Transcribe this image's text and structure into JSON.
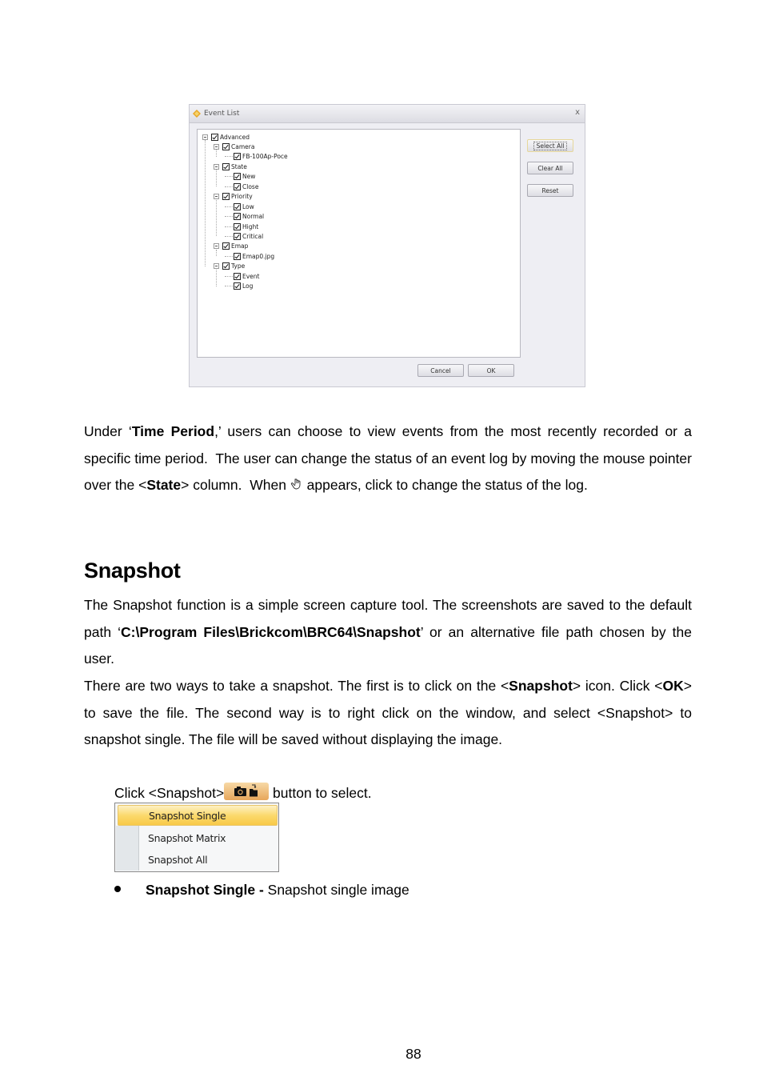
{
  "dialog": {
    "title": "Event List",
    "close_glyph": "x",
    "tree": [
      {
        "label": "Advanced",
        "level": 0,
        "expandable": true,
        "checked": true
      },
      {
        "label": "Camera",
        "level": 1,
        "expandable": true,
        "checked": true
      },
      {
        "label": "FB-100Ap-Poce",
        "level": 2,
        "expandable": false,
        "checked": true
      },
      {
        "label": "State",
        "level": 1,
        "expandable": true,
        "checked": true
      },
      {
        "label": "New",
        "level": 2,
        "expandable": false,
        "checked": true
      },
      {
        "label": "Close",
        "level": 2,
        "expandable": false,
        "checked": true
      },
      {
        "label": "Priority",
        "level": 1,
        "expandable": true,
        "checked": true
      },
      {
        "label": "Low",
        "level": 2,
        "expandable": false,
        "checked": true
      },
      {
        "label": "Normal",
        "level": 2,
        "expandable": false,
        "checked": true
      },
      {
        "label": "Hight",
        "level": 2,
        "expandable": false,
        "checked": true
      },
      {
        "label": "Critical",
        "level": 2,
        "expandable": false,
        "checked": true
      },
      {
        "label": "Emap",
        "level": 1,
        "expandable": true,
        "checked": true
      },
      {
        "label": "Emap0.jpg",
        "level": 2,
        "expandable": false,
        "checked": true
      },
      {
        "label": "Type",
        "level": 1,
        "expandable": true,
        "checked": true
      },
      {
        "label": "Event",
        "level": 2,
        "expandable": false,
        "checked": true
      },
      {
        "label": "Log",
        "level": 2,
        "expandable": false,
        "checked": true
      }
    ],
    "buttons": {
      "select_all": "Select All",
      "clear_all": "Clear All",
      "reset": "Reset",
      "cancel": "Cancel",
      "ok": "OK"
    }
  },
  "para1": {
    "t1": "Under ‘",
    "b1": "Time Period",
    "t2": ",’ users can choose to view events from the most recently recorded or a specific time period.  The user can change the status of an event log by moving the mouse pointer over the <",
    "b2": "State",
    "t3": "> column.  When ",
    "icon": "hand-pointer-icon",
    "t4": " appears, click to change the status of the log."
  },
  "section": {
    "heading": "Snapshot"
  },
  "para2": {
    "t1": "The Snapshot function is a simple screen capture tool. The screenshots are saved to the default path ‘",
    "b1": "C:\\Program Files\\Brickcom\\BRC64\\Snapshot",
    "t2": "’ or an alternative file path chosen by the user."
  },
  "para3": {
    "t1": "There are two ways to take a snapshot. The first is to click on the <",
    "b1": "Snapshot",
    "t2": "> icon. Click <",
    "b2": "OK",
    "t3": "> to save the file. The second way is to right click on the window, and select <Snapshot> to snapshot single. The file will be saved without displaying the image."
  },
  "click_line": {
    "before": "Click <Snapshot>",
    "after": " button to select.",
    "button_icon": "camera-folder-icon"
  },
  "menu": {
    "items": [
      "Snapshot Single",
      "Snapshot Matrix",
      "Snapshot All"
    ],
    "selected_index": 0
  },
  "bullet": {
    "term": "Snapshot Single - ",
    "desc": "Snapshot single image"
  },
  "page_number": "88",
  "colors": {
    "menu_highlight": "#fbd96d",
    "snapshot_button": "#e7a65b",
    "dialog_bg": "#eeeef3"
  }
}
